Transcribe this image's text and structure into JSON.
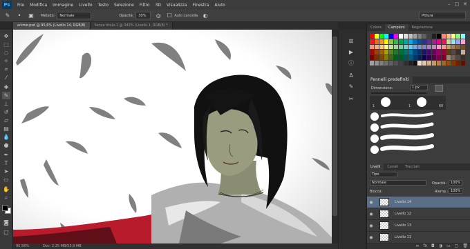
{
  "app": {
    "logo": "Ps"
  },
  "menu": [
    "File",
    "Modifica",
    "Immagine",
    "Livello",
    "Testo",
    "Selezione",
    "Filtro",
    "3D",
    "Visualizza",
    "Finestra",
    "Aiuto"
  ],
  "options": {
    "metodo_label": "Metodo:",
    "metodo_value": "Normale",
    "opacita_label": "Opacità:",
    "opacita_value": "30%",
    "auto_cancella_label": "Auto cancella",
    "workspace": "Pittura"
  },
  "tabs": [
    {
      "label": "anime.psd @ 95,6% (Livello 14, RGB/8)",
      "active": true
    },
    {
      "label": "Senza titolo-1 @ 343% (Livello 1, RGB/8) *",
      "active": false
    }
  ],
  "status": {
    "zoom": "95,56%",
    "doc": "Doc: 2,25 MB/53,9 MB"
  },
  "panels": {
    "swatch_tabs": [
      "Colore",
      "Campioni",
      "Regolazione"
    ],
    "brush_title": "Pennelli predefiniti",
    "brush_size_label": "Dimensione:",
    "brush_size_value": "1 px",
    "brush_numbers": [
      "1",
      "1",
      "60"
    ],
    "layer_tabs": [
      "Livelli",
      "Canali",
      "Tracciati"
    ],
    "layer_filter": "Tipo",
    "blend_mode": "Normale",
    "opacity_label": "Opacità:",
    "opacity_value": "100%",
    "lock_label": "Blocca:",
    "fill_label": "Riemp.:",
    "fill_value": "100%",
    "layers": [
      "Livello 14",
      "Livello 12",
      "Livello 13",
      "Livello 11"
    ]
  },
  "colors": {
    "accent": "#5a6e88",
    "cloak": "#b81c2c"
  }
}
